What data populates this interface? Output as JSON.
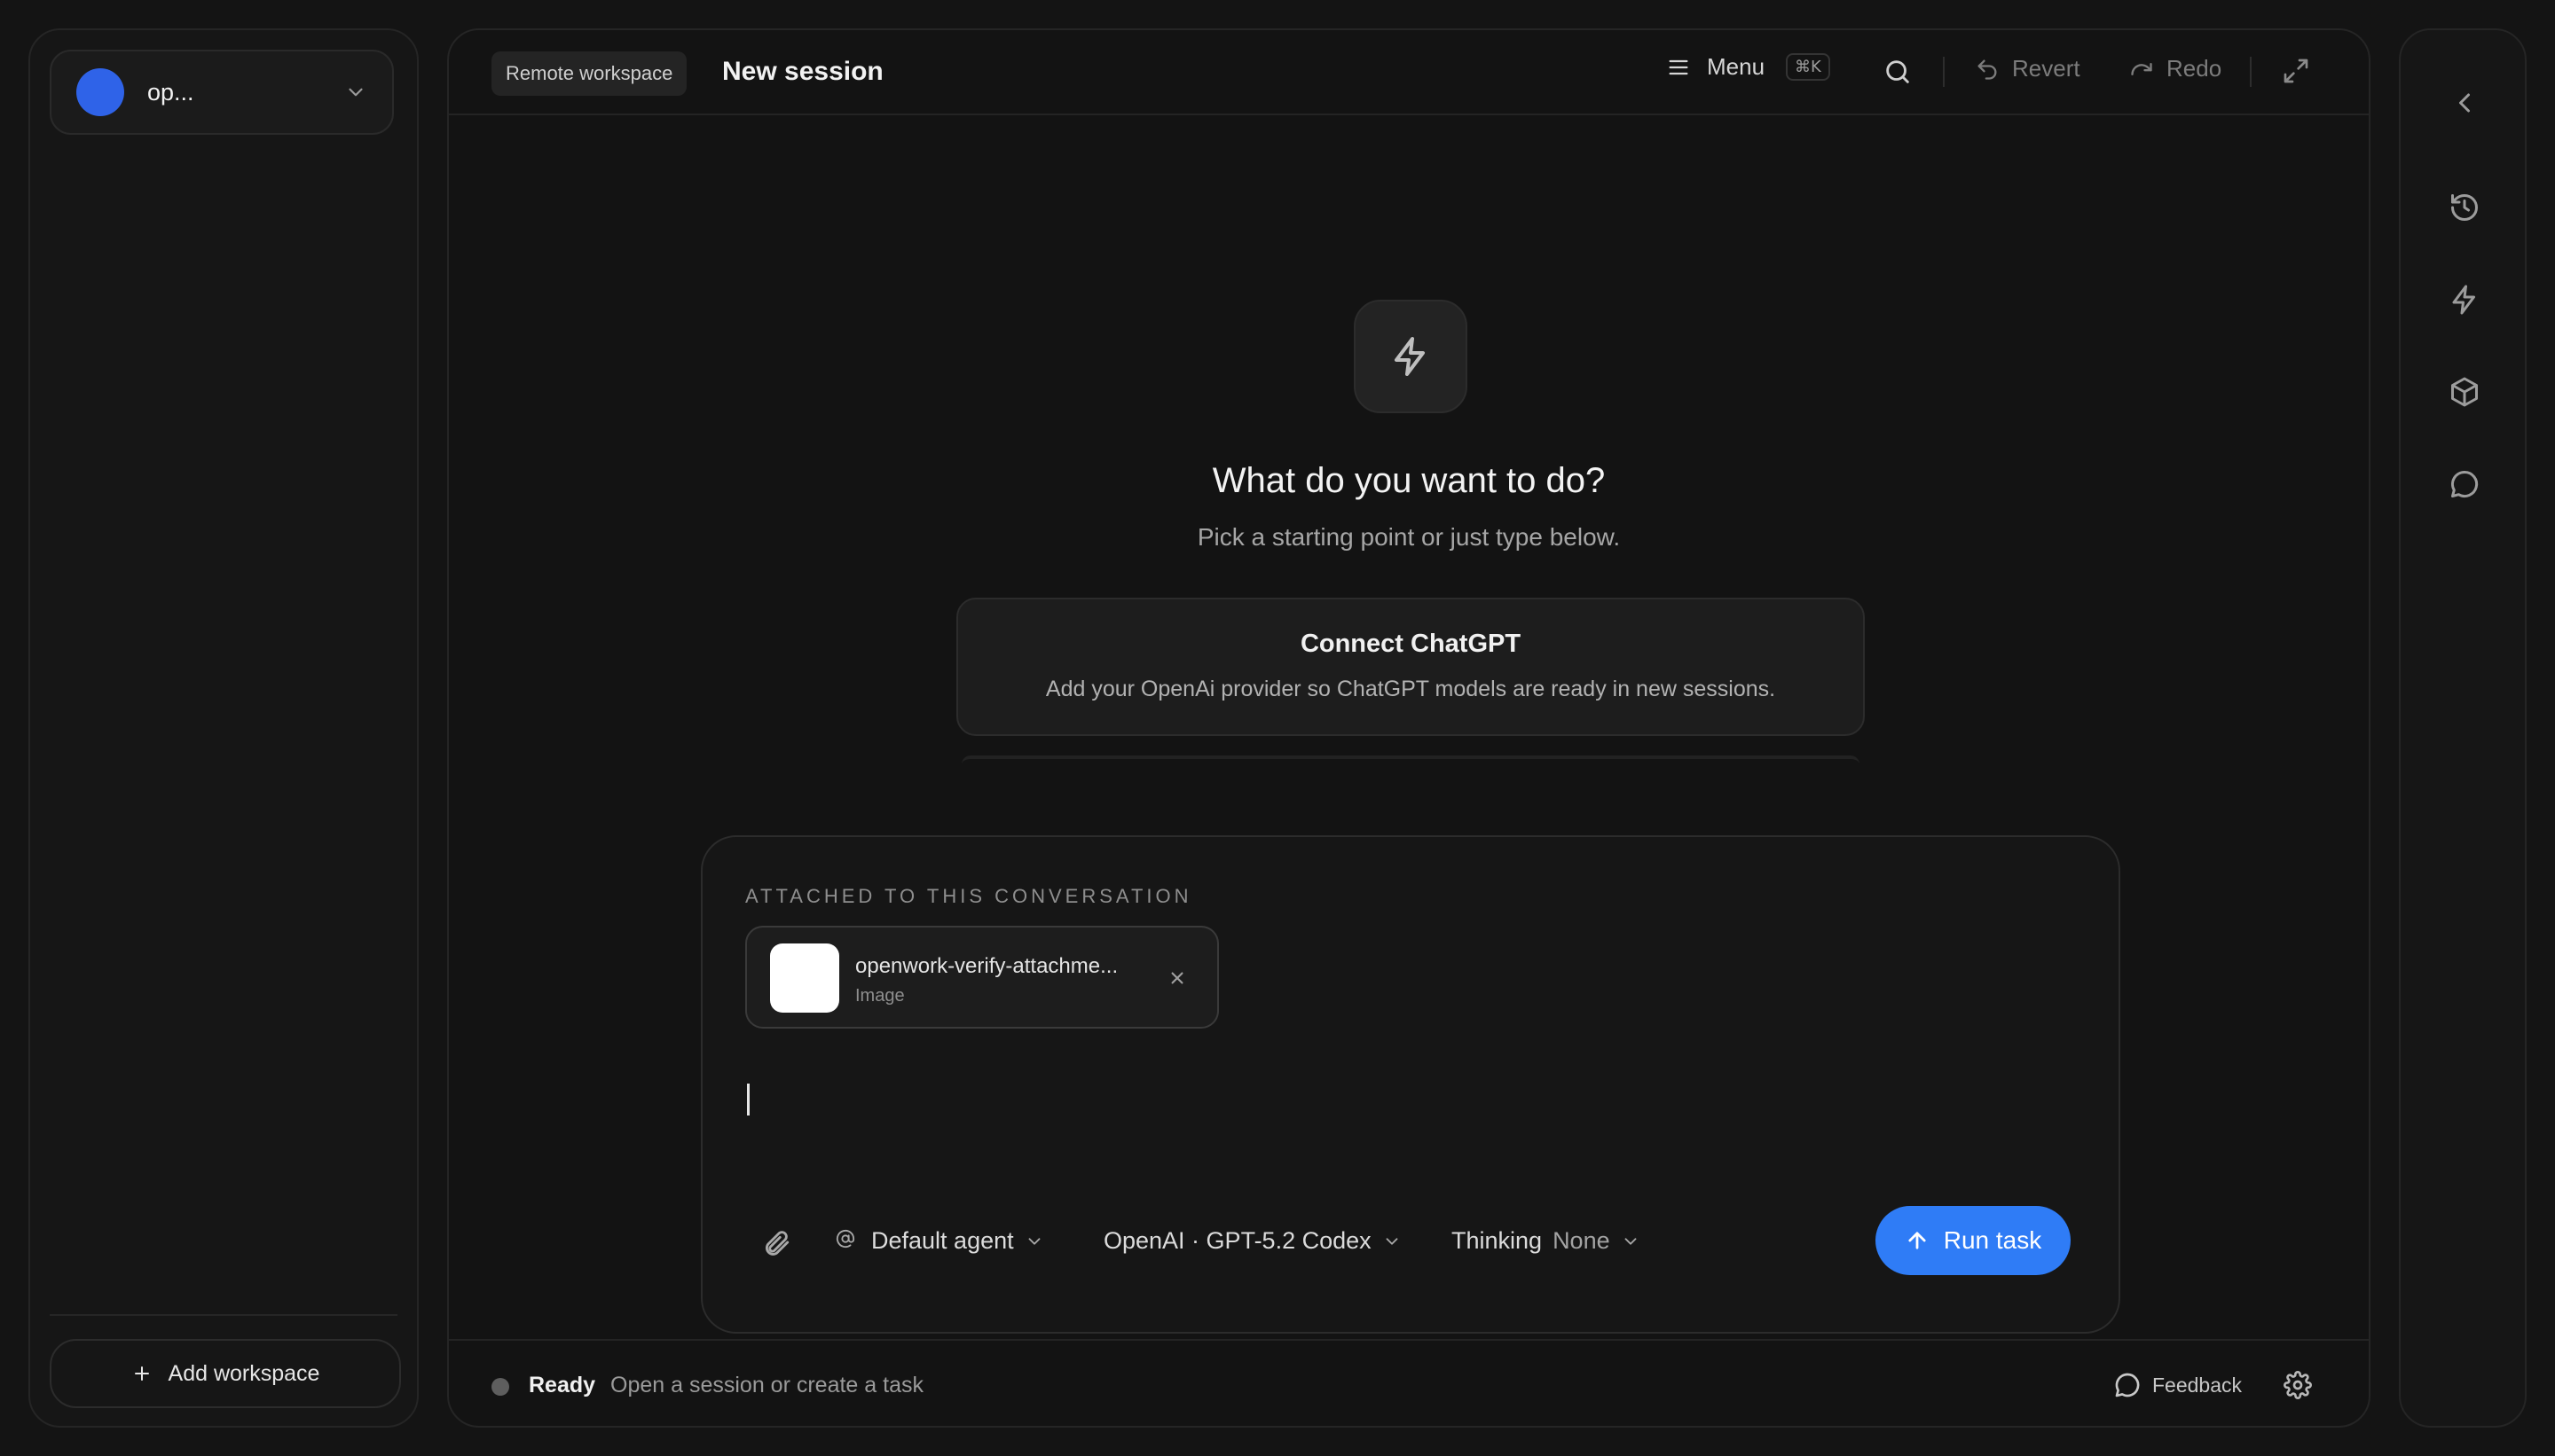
{
  "sidebar": {
    "workspace_name": "op...",
    "workspace_color": "#2f63e8",
    "add_workspace_label": "Add workspace"
  },
  "header": {
    "badge": "Remote workspace",
    "title": "New session",
    "menu_label": "Menu",
    "menu_shortcut": "⌘K",
    "revert_label": "Revert",
    "redo_label": "Redo"
  },
  "hero": {
    "title": "What do you want to do?",
    "subtitle": "Pick a starting point or just type below."
  },
  "suggestion": {
    "title": "Connect ChatGPT",
    "description": "Add your OpenAi provider so ChatGPT models are ready in new sessions."
  },
  "composer": {
    "attachments_heading": "ATTACHED TO THIS CONVERSATION",
    "attachment": {
      "name": "openwork-verify-attachme...",
      "type": "Image"
    },
    "prompt_value": "",
    "agent": "Default agent",
    "model": "OpenAI · GPT-5.2 Codex",
    "thinking_label": "Thinking",
    "thinking_value": "None",
    "run_label": "Run task",
    "accent_color": "#2f7cf6"
  },
  "status": {
    "label": "Ready",
    "text": "Open a session or create a task",
    "feedback_label": "Feedback"
  },
  "icons": [
    "chevron-down-icon",
    "plus-icon",
    "menu-icon",
    "search-icon",
    "undo-icon",
    "redo-icon",
    "expand-icon",
    "lightning-icon",
    "close-icon",
    "paperclip-icon",
    "at-icon",
    "arrow-up-icon",
    "message-icon",
    "gear-icon",
    "chevron-left-icon",
    "history-icon",
    "cube-icon"
  ]
}
